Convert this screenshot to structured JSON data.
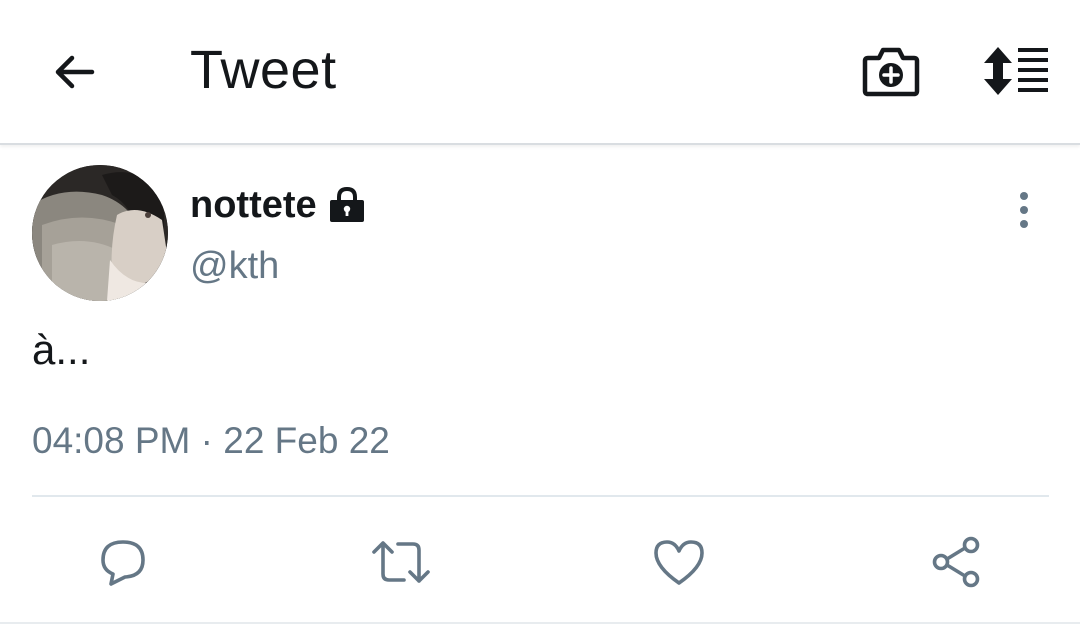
{
  "header": {
    "title": "Tweet",
    "back_icon": "arrow-left-icon",
    "camera_icon": "camera-plus-icon",
    "sort_icon": "sort-list-icon"
  },
  "tweet": {
    "display_name": "nottete",
    "protected_icon": "lock-icon",
    "handle": "@kth",
    "text": "à...",
    "timestamp": "04:08 PM · 22 Feb 22",
    "more_icon": "more-vertical-icon"
  },
  "actions": [
    {
      "name": "reply",
      "icon": "reply-bubble-icon"
    },
    {
      "name": "retweet",
      "icon": "retweet-icon"
    },
    {
      "name": "like",
      "icon": "heart-icon"
    },
    {
      "name": "share",
      "icon": "share-icon"
    }
  ],
  "colors": {
    "text_primary": "#14171a",
    "text_secondary": "#657786",
    "icon_secondary": "#657786",
    "divider": "#e1e8ed"
  }
}
